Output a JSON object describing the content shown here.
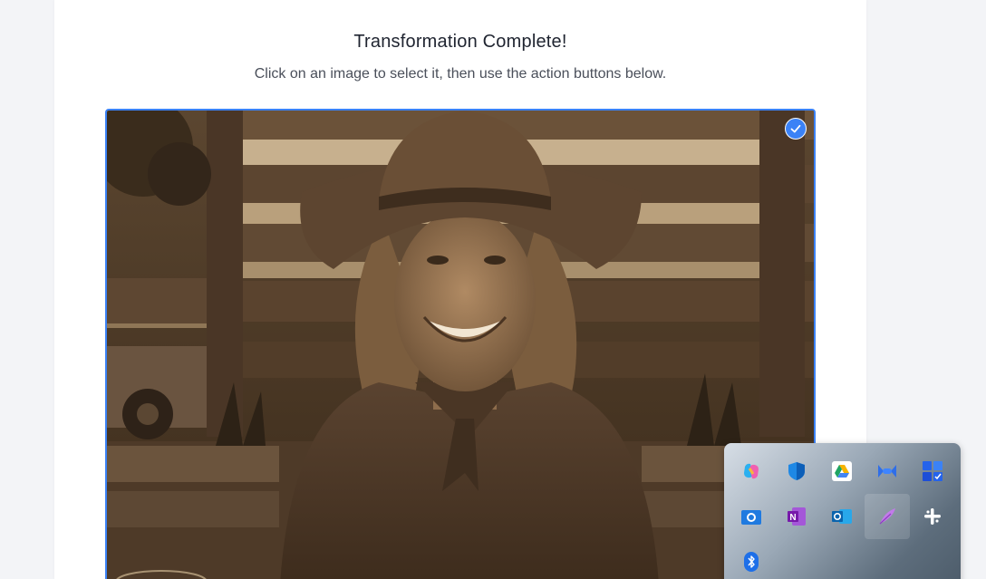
{
  "header": {
    "title": "Transformation Complete!",
    "subtitle": "Click on an image to select it, then use the action buttons below."
  },
  "selected_image": {
    "selected": true,
    "description_icon": "checkmark-icon"
  },
  "colors": {
    "accent": "#3b82f6",
    "title": "#1f2430",
    "subtitle": "#4a4f5a"
  },
  "tray": {
    "icons": [
      {
        "name": "copilot-icon"
      },
      {
        "name": "defender-icon"
      },
      {
        "name": "google-drive-icon"
      },
      {
        "name": "meeting-app-icon"
      },
      {
        "name": "tasks-app-icon"
      },
      {
        "name": "camera-app-icon"
      },
      {
        "name": "onenote-icon"
      },
      {
        "name": "outlook-icon"
      },
      {
        "name": "feather-pen-icon"
      },
      {
        "name": "slack-icon"
      },
      {
        "name": "bluetooth-icon"
      }
    ]
  }
}
